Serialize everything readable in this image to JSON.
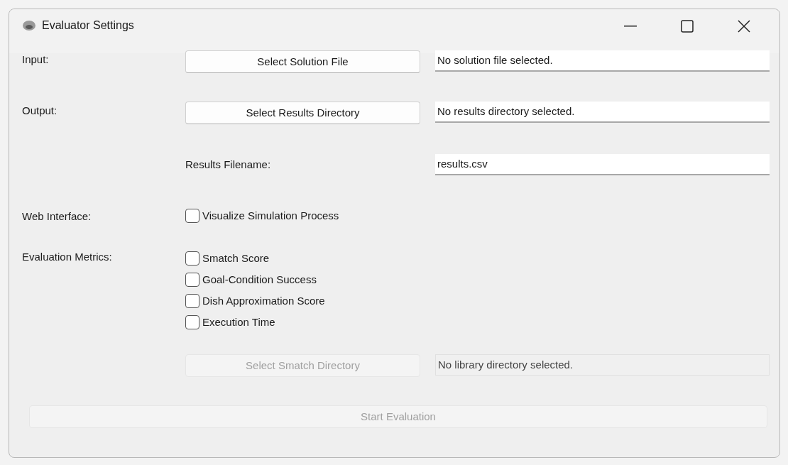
{
  "window": {
    "title": "Evaluator Settings"
  },
  "input": {
    "label": "Input:",
    "button": {
      "label": "Select Solution File",
      "disabled": false
    },
    "field": {
      "value": "No solution file selected.",
      "disabled": false
    }
  },
  "output": {
    "label": "Output:",
    "button": {
      "label": "Select Results Directory",
      "disabled": false
    },
    "field": {
      "value": "No results directory selected.",
      "disabled": false
    }
  },
  "results_filename": {
    "label": "Results Filename:",
    "field": {
      "value": "results.csv",
      "disabled": false
    }
  },
  "web_interface": {
    "label": "Web Interface:",
    "checkboxes": [
      {
        "label": "Visualize Simulation Process",
        "checked": false
      }
    ]
  },
  "evaluation_metrics": {
    "label": "Evaluation Metrics:",
    "checkboxes": [
      {
        "label": "Smatch Score",
        "checked": false
      },
      {
        "label": "Goal-Condition Success",
        "checked": false
      },
      {
        "label": "Dish Approximation Score",
        "checked": false
      },
      {
        "label": "Execution Time",
        "checked": false
      }
    ]
  },
  "smatch": {
    "button": {
      "label": "Select Smatch Directory",
      "disabled": true
    },
    "field": {
      "value": "No library directory selected.",
      "disabled": true
    }
  },
  "start_button": {
    "label": "Start Evaluation",
    "disabled": true
  }
}
